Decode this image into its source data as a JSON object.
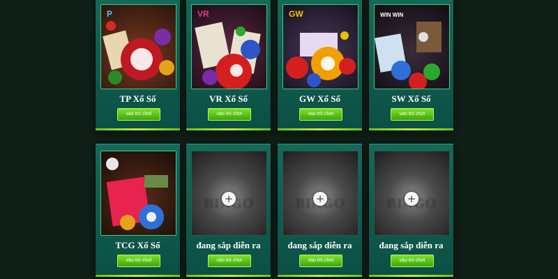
{
  "cards": [
    {
      "logo": "P",
      "title": "TP Xổ Số",
      "button": "vào trò chơi",
      "accent": "#c01825"
    },
    {
      "logo": "VR",
      "title": "VR Xổ Số",
      "button": "vào trò chơi",
      "accent": "#d41f1f"
    },
    {
      "logo": "GW",
      "title": "GW Xổ Số",
      "button": "vào trò chơi",
      "accent": "#f0a000"
    },
    {
      "logo": "WIN WIN",
      "title": "SW Xổ Số",
      "button": "vào trò chơi",
      "accent": "#2f6fd8"
    },
    {
      "logo": "",
      "title": "TCG Xổ Số",
      "button": "vào trò chơi",
      "accent": "#e8234f"
    },
    {
      "title": "đang sắp diễn ra",
      "button": "vào trò chơi",
      "placeholder_text": "BINGO"
    },
    {
      "title": "đang sắp diễn ra",
      "button": "vào trò chơi",
      "placeholder_text": "BINGO"
    },
    {
      "title": "đang sắp diễn ra",
      "button": "vào trò chơi",
      "placeholder_text": "BINGO"
    }
  ],
  "icons": {
    "coming_soon": "plus-icon"
  }
}
